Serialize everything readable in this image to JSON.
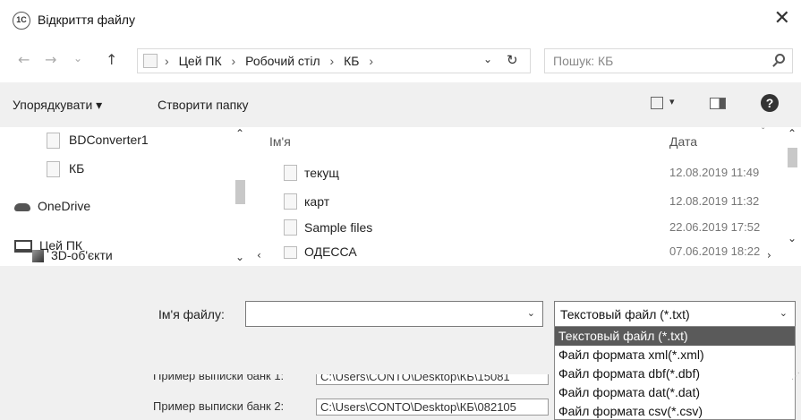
{
  "window": {
    "title": "Відкриття файлу",
    "app_icon_text": "1С",
    "close": "✕"
  },
  "nav": {
    "back": "←",
    "forward": "→",
    "recent": "⌄",
    "up": "↑",
    "breadcrumbs": [
      "Цей ПК",
      "Робочий стіл",
      "КБ"
    ],
    "crumb_sep": "›",
    "address_dropdown": "⌄",
    "refresh": "↻",
    "search_placeholder": "Пошук: КБ"
  },
  "toolbar": {
    "organize": "Упорядкувати ▾",
    "new_folder": "Створити папку",
    "view_dropdown": "▾",
    "help": "?"
  },
  "sidebar": {
    "items": [
      {
        "label": "BDConverter1",
        "icon": "folder-icon"
      },
      {
        "label": "КБ",
        "icon": "folder-icon"
      },
      {
        "label": "OneDrive",
        "icon": "cloud-icon"
      },
      {
        "label": "Цей ПК",
        "icon": "computer-icon"
      },
      {
        "label": "3D-об'єкти",
        "icon": "cube-icon"
      }
    ]
  },
  "filelist": {
    "col_name": "Ім'я",
    "col_date": "Дата",
    "sort_indicator": "ˇ",
    "rows": [
      {
        "name": "текущ",
        "date": "12.08.2019 11:49"
      },
      {
        "name": "карт",
        "date": "12.08.2019 11:32"
      },
      {
        "name": "Sample files",
        "date": "22.06.2019 17:52"
      },
      {
        "name": "ОДЕССА",
        "date": "07.06.2019 18:22"
      }
    ]
  },
  "scroll": {
    "up": "⌃",
    "down": "⌄",
    "left": "‹",
    "right": "›"
  },
  "bottom": {
    "filename_label": "Ім'я файлу:",
    "filename_value": "",
    "dropdown_arrow": "⌄",
    "filetype_selected": "Текстовый файл (*.txt)",
    "filetype_options": [
      "Текстовый файл (*.txt)",
      "Файл формата xml(*.xml)",
      "Файл формата dbf(*.dbf)",
      "Файл формата dat(*.dat)",
      "Файл формата csv(*.csv)"
    ]
  },
  "background_form": {
    "rows": [
      {
        "label": "Пример выписки банк 1:",
        "value": "C:\\Users\\CONTO\\Desktop\\КБ\\15081"
      },
      {
        "label": "Пример выписки банк 2:",
        "value": "C:\\Users\\CONTO\\Desktop\\КБ\\082105"
      }
    ]
  },
  "colors": {
    "selected_option_bg": "#5a5a5a",
    "toolbar_bg": "#f0f0f0"
  }
}
